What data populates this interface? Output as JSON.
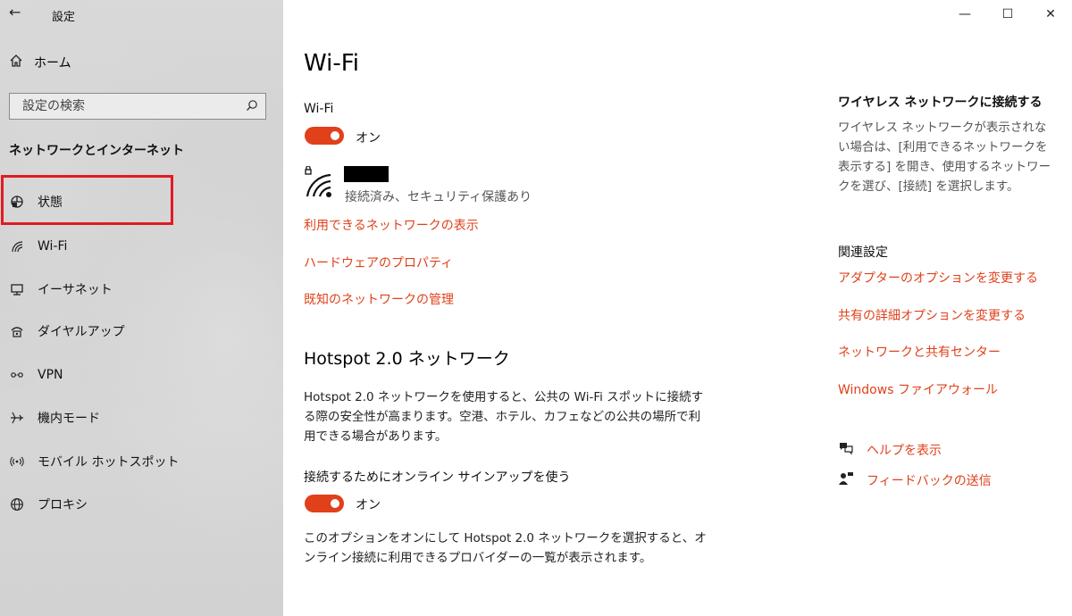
{
  "window": {
    "title": "設定"
  },
  "sidebar": {
    "home_label": "ホーム",
    "search_placeholder": "設定の検索",
    "section_title": "ネットワークとインターネット",
    "items": [
      {
        "label": "状態",
        "icon": "status-icon"
      },
      {
        "label": "Wi-Fi",
        "icon": "wifi-icon"
      },
      {
        "label": "イーサネット",
        "icon": "ethernet-icon"
      },
      {
        "label": "ダイヤルアップ",
        "icon": "dialup-icon"
      },
      {
        "label": "VPN",
        "icon": "vpn-icon"
      },
      {
        "label": "機内モード",
        "icon": "airplane-icon"
      },
      {
        "label": "モバイル ホットスポット",
        "icon": "hotspot-icon"
      },
      {
        "label": "プロキシ",
        "icon": "globe-icon"
      }
    ]
  },
  "main": {
    "title": "Wi-Fi",
    "wifi_label": "Wi-Fi",
    "wifi_toggle": "オン",
    "connection_status": "接続済み、セキュリティ保護あり",
    "links": [
      "利用できるネットワークの表示",
      "ハードウェアのプロパティ",
      "既知のネットワークの管理"
    ],
    "hotspot": {
      "title": "Hotspot 2.0 ネットワーク",
      "description": "Hotspot 2.0 ネットワークを使用すると、公共の Wi-Fi スポットに接続する際の安全性が高まります。空港、ホテル、カフェなどの公共の場所で利用できる場合があります。",
      "signup_label": "接続するためにオンライン サインアップを使う",
      "signup_toggle": "オン",
      "note": "このオプションをオンにして Hotspot 2.0 ネットワークを選択すると、オンライン接続に利用できるプロバイダーの一覧が表示されます。"
    }
  },
  "right": {
    "connect_title": "ワイヤレス ネットワークに接続する",
    "connect_text": "ワイヤレス ネットワークが表示されない場合は、[利用できるネットワークを表示する] を開き、使用するネットワークを選び、[接続] を選択します。",
    "related_title": "関連設定",
    "related_links": [
      "アダプターのオプションを変更する",
      "共有の詳細オプションを変更する",
      "ネットワークと共有センター",
      "Windows ファイアウォール"
    ],
    "help_label": "ヘルプを表示",
    "feedback_label": "フィードバックの送信"
  },
  "colors": {
    "accent": "#e0401a",
    "highlight": "#e21a23"
  }
}
